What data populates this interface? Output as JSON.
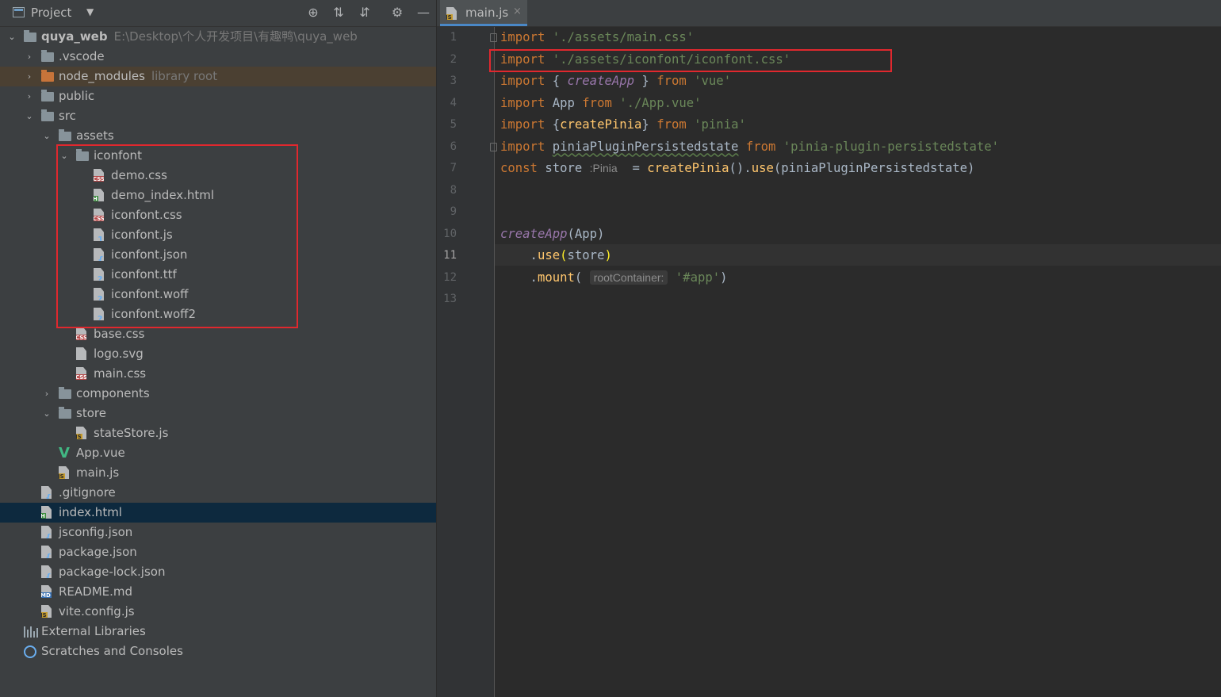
{
  "project_panel": {
    "title": "Project",
    "caret": "▼",
    "tools": [
      {
        "name": "locate-icon",
        "glyph": "⊕"
      },
      {
        "name": "expand-all-icon",
        "glyph": "⇅"
      },
      {
        "name": "collapse-all-icon",
        "glyph": "⇵"
      },
      {
        "name": "gear-icon",
        "glyph": "⚙"
      },
      {
        "name": "hide-icon",
        "glyph": "—"
      }
    ]
  },
  "tree": [
    {
      "label": "quya_web",
      "hint": "E:\\Desktop\\个人开发项目\\有趣鸭\\quya_web",
      "arrow": "⌄",
      "icon": "folder",
      "bold": true
    },
    {
      "label": ".vscode",
      "arrow": "›",
      "icon": "folder"
    },
    {
      "label": "node_modules",
      "hint": "library root",
      "arrow": "›",
      "icon": "folder-orange",
      "variant": "nm"
    },
    {
      "label": "public",
      "arrow": "›",
      "icon": "folder"
    },
    {
      "label": "src",
      "arrow": "⌄",
      "icon": "folder"
    },
    {
      "label": "assets",
      "arrow": "⌄",
      "icon": "folder"
    },
    {
      "label": "iconfont",
      "arrow": "⌄",
      "icon": "folder"
    },
    {
      "label": "demo.css",
      "icon": "css",
      "badge": "CSS"
    },
    {
      "label": "demo_index.html",
      "icon": "html",
      "badge": "H"
    },
    {
      "label": "iconfont.css",
      "icon": "css",
      "badge": "CSS"
    },
    {
      "label": "iconfont.js",
      "icon": "jsbin",
      "badge": "101"
    },
    {
      "label": "iconfont.json",
      "icon": "json",
      "badge": "{}"
    },
    {
      "label": "iconfont.ttf",
      "icon": "unknown",
      "badge": "?"
    },
    {
      "label": "iconfont.woff",
      "icon": "unknown",
      "badge": "?"
    },
    {
      "label": "iconfont.woff2",
      "icon": "unknown",
      "badge": "?"
    },
    {
      "label": "base.css",
      "icon": "css",
      "badge": "CSS"
    },
    {
      "label": "logo.svg",
      "icon": "svg",
      "badge": ""
    },
    {
      "label": "main.css",
      "icon": "css",
      "badge": "CSS"
    },
    {
      "label": "components",
      "arrow": "›",
      "icon": "folder"
    },
    {
      "label": "store",
      "arrow": "⌄",
      "icon": "folder"
    },
    {
      "label": "stateStore.js",
      "icon": "js",
      "badge": "JS"
    },
    {
      "label": "App.vue",
      "icon": "vue",
      "badge": "V"
    },
    {
      "label": "main.js",
      "icon": "js",
      "badge": "JS"
    },
    {
      "label": ".gitignore",
      "icon": "json",
      "badge": "{}"
    },
    {
      "label": "index.html",
      "icon": "html",
      "badge": "H",
      "variant": "sel"
    },
    {
      "label": "jsconfig.json",
      "icon": "json",
      "badge": "{}"
    },
    {
      "label": "package.json",
      "icon": "json",
      "badge": "{}"
    },
    {
      "label": "package-lock.json",
      "icon": "json",
      "badge": "{}"
    },
    {
      "label": "README.md",
      "icon": "md",
      "badge": "MD"
    },
    {
      "label": "vite.config.js",
      "icon": "js",
      "badge": "JS"
    },
    {
      "label": "External Libraries",
      "icon": "lib"
    },
    {
      "label": "Scratches and Consoles",
      "icon": "scratch"
    }
  ],
  "editor": {
    "tab": {
      "label": "main.js",
      "close": "×",
      "badge": "JS"
    },
    "line_numbers": [
      "1",
      "2",
      "3",
      "4",
      "5",
      "6",
      "7",
      "8",
      "9",
      "10",
      "11",
      "12",
      "13"
    ],
    "current_line": "11",
    "lines": [
      [
        {
          "t": "import",
          "c": "kw"
        },
        {
          "t": " "
        },
        {
          "t": "'./assets/main.css'",
          "c": "str"
        }
      ],
      [
        {
          "t": "import",
          "c": "kw"
        },
        {
          "t": " "
        },
        {
          "t": "'./assets/iconfont/iconfont.css'",
          "c": "str"
        }
      ],
      [
        {
          "t": "import",
          "c": "kw"
        },
        {
          "t": " { "
        },
        {
          "t": "createApp",
          "c": "fni"
        },
        {
          "t": " } "
        },
        {
          "t": "from",
          "c": "kw"
        },
        {
          "t": " "
        },
        {
          "t": "'vue'",
          "c": "str"
        }
      ],
      [
        {
          "t": "import",
          "c": "kw"
        },
        {
          "t": " App "
        },
        {
          "t": "from",
          "c": "kw"
        },
        {
          "t": " "
        },
        {
          "t": "'./App.vue'",
          "c": "str"
        }
      ],
      [
        {
          "t": "import",
          "c": "kw"
        },
        {
          "t": " {"
        },
        {
          "t": "createPinia",
          "c": "fn"
        },
        {
          "t": "} "
        },
        {
          "t": "from",
          "c": "kw"
        },
        {
          "t": " "
        },
        {
          "t": "'pinia'",
          "c": "str"
        }
      ],
      [
        {
          "t": "import",
          "c": "kw"
        },
        {
          "t": " "
        },
        {
          "t": "piniaPluginPersistedstate",
          "c": "wavy"
        },
        {
          "t": " "
        },
        {
          "t": "from",
          "c": "kw"
        },
        {
          "t": " "
        },
        {
          "t": "'pinia-plugin-persistedstate'",
          "c": "str"
        }
      ],
      [
        {
          "t": "const",
          "c": "kw"
        },
        {
          "t": " store "
        },
        {
          "t": ":Pinia",
          "c": "inlay"
        },
        {
          "t": "  = "
        },
        {
          "t": "createPinia",
          "c": "fn"
        },
        {
          "t": "()."
        },
        {
          "t": "use",
          "c": "fn"
        },
        {
          "t": "(piniaPluginPersistedstate)"
        }
      ],
      [],
      [],
      [
        {
          "t": "createApp",
          "c": "fni"
        },
        {
          "t": "(App)"
        }
      ],
      [
        {
          "t": "    ."
        },
        {
          "t": "use",
          "c": "fn"
        },
        {
          "t": "(",
          "c": "bracket"
        },
        {
          "t": "store"
        },
        {
          "t": ")",
          "c": "bracket"
        }
      ],
      [
        {
          "t": "    ."
        },
        {
          "t": "mount",
          "c": "fn"
        },
        {
          "t": "( "
        },
        {
          "t": "rootContainer:",
          "c": "inlay-box"
        },
        {
          "t": " "
        },
        {
          "t": "'#app'",
          "c": "str"
        },
        {
          "t": ")"
        }
      ],
      []
    ]
  },
  "colors": {
    "highlight_box": "#e0282e",
    "keyword": "#cc7832",
    "string": "#6a8759",
    "function": "#ffc66d"
  }
}
